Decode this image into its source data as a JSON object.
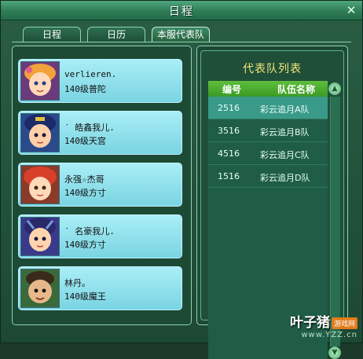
{
  "window": {
    "title": "日程",
    "close_icon": "close-icon"
  },
  "tabs": [
    {
      "label": "日程",
      "active": false
    },
    {
      "label": "日历",
      "active": false
    },
    {
      "label": "本服代表队",
      "active": true
    }
  ],
  "members": [
    {
      "name": "verlieren.",
      "level_class": "140级普陀"
    },
    {
      "name": "ˊ 皓鑫我儿.",
      "level_class": "140级天宫"
    },
    {
      "name": "永强☆杰哥",
      "level_class": "140级方寸"
    },
    {
      "name": "ˊ 名豪我儿.",
      "level_class": "140级方寸"
    },
    {
      "name": "林丹。",
      "level_class": "140级魔王"
    }
  ],
  "team_list": {
    "title": "代表队列表",
    "headers": {
      "number": "编号",
      "team_name": "队伍名称"
    },
    "rows": [
      {
        "number": "2516",
        "team_name": "彩云追月A队",
        "selected": true
      },
      {
        "number": "3516",
        "team_name": "彩云追月B队",
        "selected": false
      },
      {
        "number": "4516",
        "team_name": "彩云追月C队",
        "selected": false
      },
      {
        "number": "1516",
        "team_name": "彩云追月D队",
        "selected": false
      }
    ]
  },
  "watermark": {
    "main": "叶子猪",
    "badge": "游戏网",
    "url": "www.YZZ.cn"
  },
  "colors": {
    "accent_green": "#5fbf3c",
    "title_yellow": "#f2e77a",
    "card_cyan": "#a9eef6"
  }
}
